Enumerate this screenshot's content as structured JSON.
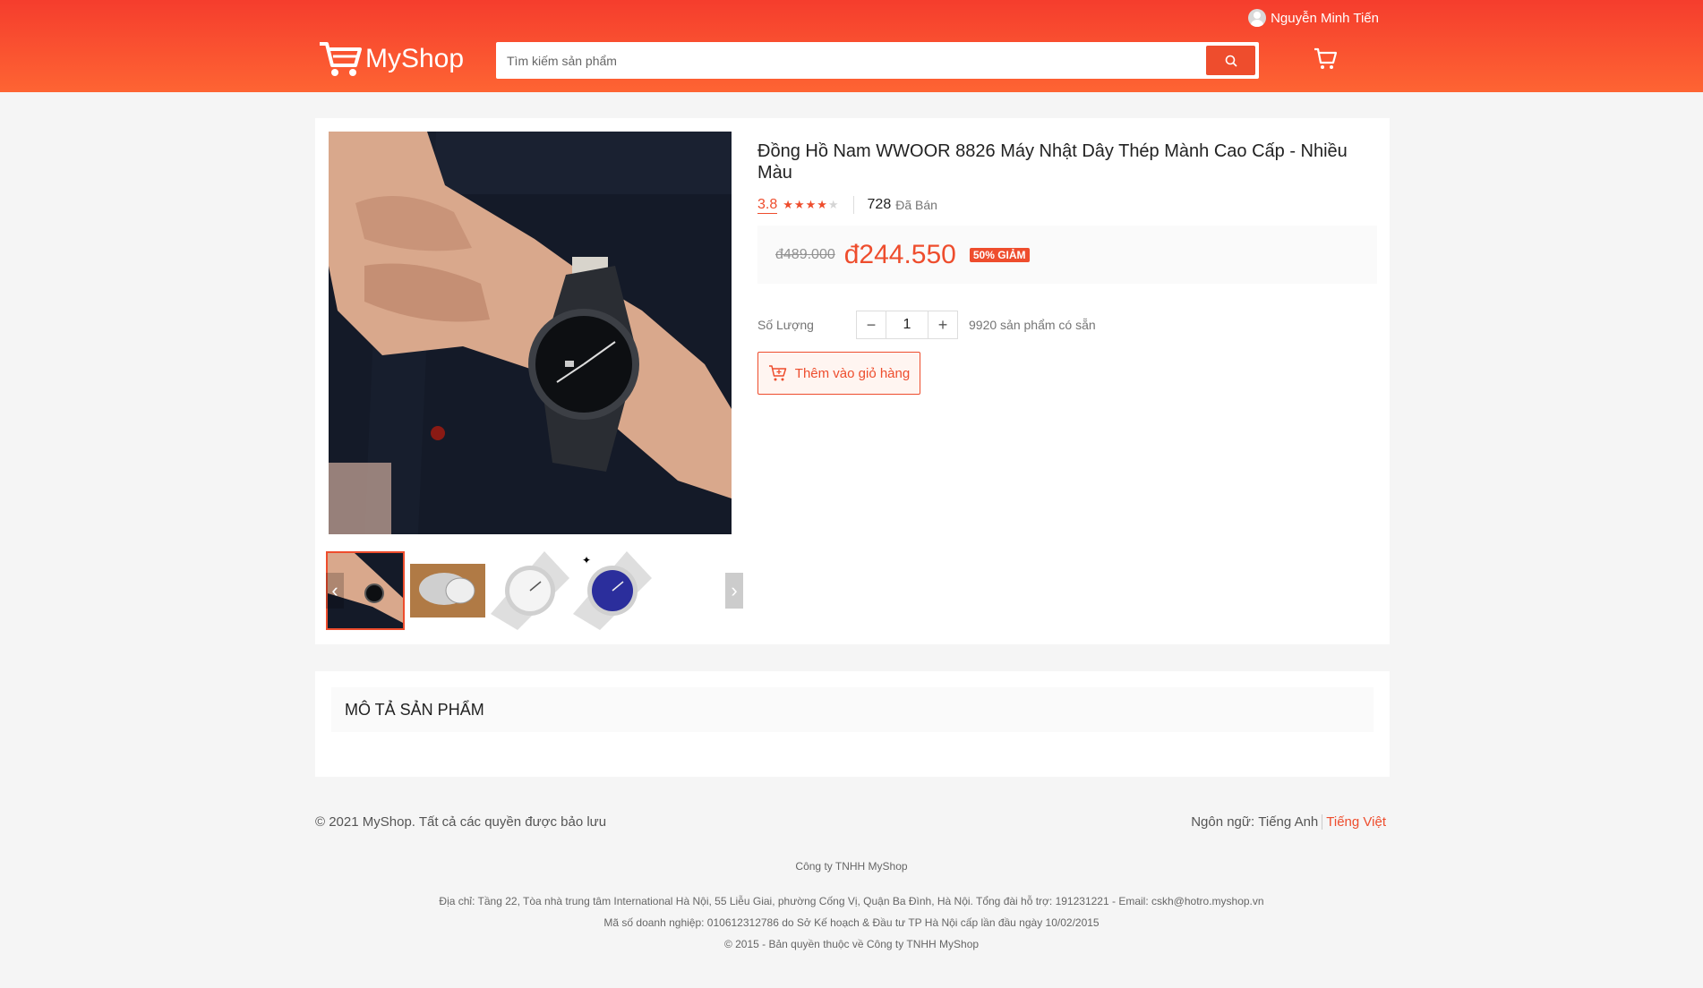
{
  "header": {
    "user_name": "Nguyễn Minh Tiến",
    "logo_text": "MyShop",
    "search_placeholder": "Tìm kiếm sản phẩm"
  },
  "product": {
    "title": "Đồng Hồ Nam WWOOR 8826 Máy Nhật Dây Thép Mành Cao Cấp - Nhiều Màu",
    "rating": "3.8",
    "rating_value": 3.8,
    "sold_count": "728",
    "sold_label": "Đã Bán",
    "old_price": "đ489.000",
    "new_price": "đ244.550",
    "discount_badge": "50% GIẢM",
    "quantity_label": "Số Lượng",
    "quantity_value": "1",
    "minus_symbol": "−",
    "plus_symbol": "+",
    "stock_text": "9920 sản phẩm có sẵn",
    "add_to_cart_label": "Thêm vào giỏ hàng",
    "prev_arrow": "‹",
    "next_arrow": "›"
  },
  "description": {
    "heading": "MÔ TẢ SẢN PHẨM"
  },
  "footer": {
    "copyright": "© 2021 MyShop. Tất cả các quyền được bảo lưu",
    "language_label": "Ngôn ngữ:",
    "lang_en": "Tiếng Anh",
    "lang_vi": "Tiếng Việt",
    "company": "Công ty TNHH MyShop",
    "address": "Địa chỉ: Tầng 22, Tòa nhà trung tâm International Hà Nội, 55 Liễu Giai, phường Cống Vị, Quận Ba Đình, Hà Nội. Tổng đài hỗ trợ: 191231221 - Email: cskh@hotro.myshop.vn",
    "business_code": "Mã số doanh nghiệp: 010612312786 do Sở Kế hoạch & Đầu tư TP Hà Nội cấp lần đầu ngày 10/02/2015",
    "rights": "© 2015 - Bản quyền thuộc về Công ty TNHH MyShop"
  },
  "icons": {
    "logo": "cart-logo-icon",
    "search": "search-icon",
    "cart": "cart-icon",
    "user": "user-avatar-icon",
    "add_to_cart": "add-cart-icon"
  },
  "colors": {
    "brand": "#ee4d2d",
    "header_gradient_top": "#f53d2d",
    "header_gradient_bottom": "#fe6433",
    "background": "#f5f5f5"
  }
}
